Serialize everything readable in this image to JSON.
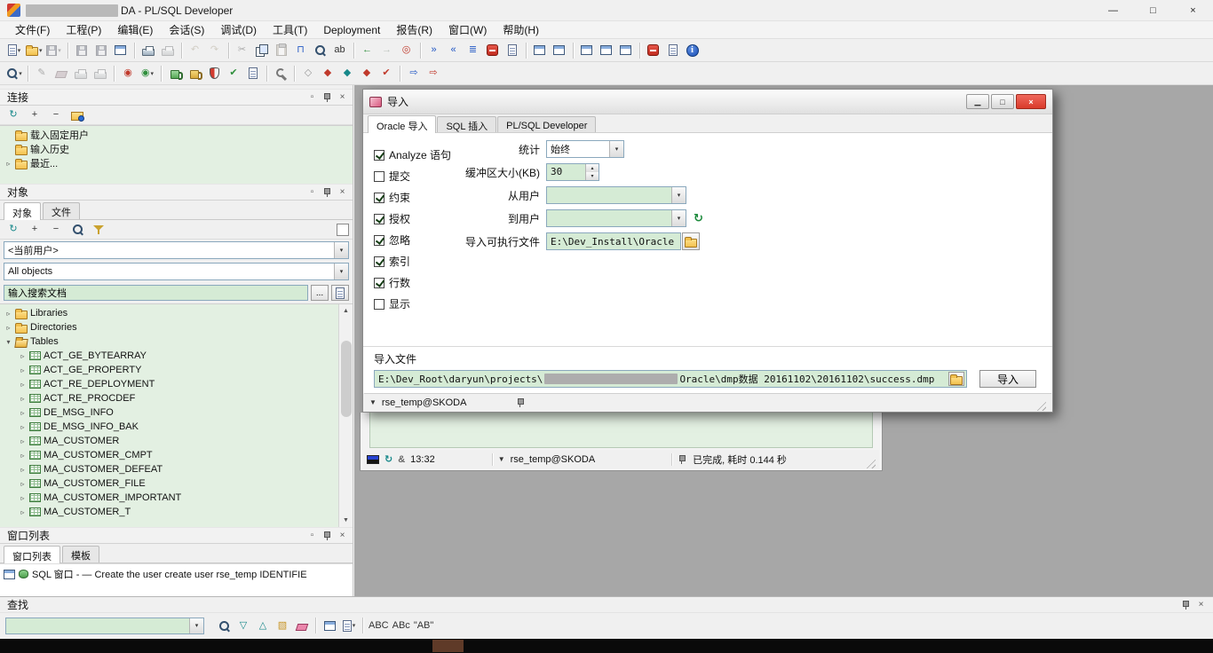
{
  "window": {
    "title_visible": "DA - PL/SQL Developer",
    "controls": {
      "minimize": "—",
      "maximize": "□",
      "close": "×"
    }
  },
  "menu": {
    "items": [
      {
        "label": "文件(F)",
        "name": "menu-file"
      },
      {
        "label": "工程(P)",
        "name": "menu-project"
      },
      {
        "label": "编辑(E)",
        "name": "menu-edit"
      },
      {
        "label": "会话(S)",
        "name": "menu-session"
      },
      {
        "label": "调试(D)",
        "name": "menu-debug"
      },
      {
        "label": "工具(T)",
        "name": "menu-tools"
      },
      {
        "label": "Deployment",
        "name": "menu-deployment"
      },
      {
        "label": "报告(R)",
        "name": "menu-reports"
      },
      {
        "label": "窗口(W)",
        "name": "menu-window"
      },
      {
        "label": "帮助(H)",
        "name": "menu-help"
      }
    ]
  },
  "toolbar1": {
    "items": [
      {
        "name": "new-icon",
        "icon": "doc",
        "dd": "▾"
      },
      {
        "name": "open-icon",
        "icon": "folder",
        "dd": "▾"
      },
      {
        "name": "save-as-icon",
        "icon": "floppy",
        "grayed": true,
        "dd": "▾"
      },
      {
        "name": "separator",
        "type": "sep",
        "ia": "false"
      },
      {
        "name": "save-icon",
        "icon": "floppy",
        "grayed": true
      },
      {
        "name": "save-all-icon",
        "icon": "floppy",
        "grayed": true
      },
      {
        "name": "close-window-icon",
        "icon": "win"
      },
      {
        "name": "separator",
        "type": "sep",
        "ia": "false"
      },
      {
        "name": "print-icon",
        "icon": "printer"
      },
      {
        "name": "print-preview-icon",
        "icon": "printer",
        "grayed": true
      },
      {
        "name": "separator",
        "type": "sep",
        "ia": "false"
      },
      {
        "name": "undo-icon",
        "g": "↶",
        "tone": "gold",
        "grayed": true
      },
      {
        "name": "redo-icon",
        "g": "↷",
        "tone": "gold",
        "grayed": true
      },
      {
        "name": "separator",
        "type": "sep",
        "ia": "false"
      },
      {
        "name": "cut-icon",
        "g": "✂",
        "tone": "dark",
        "grayed": true
      },
      {
        "name": "copy-icon",
        "icon": "copy"
      },
      {
        "name": "paste-icon",
        "icon": "paste",
        "grayed": true
      },
      {
        "name": "clamp-icon",
        "g": "⊓",
        "tone": "blue"
      },
      {
        "name": "find-icon",
        "icon": "magnifier"
      },
      {
        "name": "replace-icon",
        "g": "ab",
        "tone": "dark"
      },
      {
        "name": "separator",
        "type": "sep",
        "ia": "false"
      },
      {
        "name": "back-icon",
        "g": "←",
        "tone": "green"
      },
      {
        "name": "forward-icon",
        "g": "→",
        "tone": "green",
        "grayed": true
      },
      {
        "name": "navigator-icon",
        "g": "◎",
        "tone": "red"
      },
      {
        "name": "separator",
        "type": "sep",
        "ia": "false"
      },
      {
        "name": "indent-icon",
        "g": "»",
        "tone": "blue"
      },
      {
        "name": "outdent-icon",
        "g": "«",
        "tone": "blue"
      },
      {
        "name": "sort-icon",
        "g": "≣",
        "tone": "blue"
      },
      {
        "name": "stop-icon",
        "icon": "stop"
      },
      {
        "name": "log-icon",
        "icon": "doc"
      },
      {
        "name": "separator",
        "type": "sep",
        "ia": "false"
      },
      {
        "name": "next-window-icon",
        "icon": "win"
      },
      {
        "name": "window-list-icon",
        "icon": "win"
      },
      {
        "name": "separator",
        "type": "sep",
        "ia": "false"
      },
      {
        "name": "tile-windows-icon",
        "icon": "win"
      },
      {
        "name": "cascade-windows-icon",
        "icon": "win"
      },
      {
        "name": "layout-windows-icon",
        "icon": "win"
      },
      {
        "name": "separator",
        "type": "sep",
        "ia": "false"
      },
      {
        "name": "record-stop-icon",
        "icon": "stop"
      },
      {
        "name": "report-icon",
        "icon": "doc"
      },
      {
        "name": "about-icon",
        "icon": "info"
      }
    ]
  },
  "toolbar2": {
    "items": [
      {
        "name": "zoom-icon",
        "icon": "magnifier",
        "dd": "▾"
      },
      {
        "name": "separator",
        "type": "sep",
        "ia": "false"
      },
      {
        "name": "edit-data-icon",
        "g": "✎",
        "tone": "dark",
        "grayed": true
      },
      {
        "name": "eraser-icon",
        "icon": "eraser",
        "grayed": true
      },
      {
        "name": "print-result-icon",
        "icon": "printer",
        "grayed": true
      },
      {
        "name": "export-icon",
        "icon": "printer",
        "grayed": true
      },
      {
        "name": "separator",
        "type": "sep",
        "ia": "false"
      },
      {
        "name": "stamp-icon",
        "g": "◉",
        "tone": "red"
      },
      {
        "name": "stamp-options-icon",
        "g": "◉",
        "tone": "green",
        "dd": "▾"
      },
      {
        "name": "separator",
        "type": "sep",
        "ia": "false"
      },
      {
        "name": "commit-icon",
        "icon": "mug",
        "tone": "green"
      },
      {
        "name": "rollback-icon",
        "icon": "mug",
        "tone": "gold"
      },
      {
        "name": "compile-icon",
        "icon": "shield"
      },
      {
        "name": "syntax-check-icon",
        "g": "✔",
        "tone": "green"
      },
      {
        "name": "describe-icon",
        "icon": "doc"
      },
      {
        "name": "separator",
        "type": "sep",
        "ia": "false"
      },
      {
        "name": "preferences-icon",
        "icon": "wrench"
      },
      {
        "name": "separator",
        "type": "sep",
        "ia": "false"
      },
      {
        "name": "breakpoint-off-icon",
        "g": "◇",
        "tone": "gray"
      },
      {
        "name": "breakpoint-icon",
        "g": "◆",
        "tone": "red"
      },
      {
        "name": "watch-icon",
        "g": "◆",
        "tone": "teal"
      },
      {
        "name": "breakpoint-2-icon",
        "g": "◆",
        "tone": "red"
      },
      {
        "name": "test-icon",
        "g": "✔",
        "tone": "red"
      },
      {
        "name": "separator",
        "type": "sep",
        "ia": "false"
      },
      {
        "name": "step-into-icon",
        "g": "⇨",
        "tone": "blue"
      },
      {
        "name": "run-icon",
        "g": "⇨",
        "tone": "red"
      }
    ]
  },
  "connections": {
    "title": "连接",
    "toolbar": [
      {
        "name": "refresh-connections-icon",
        "g": "↻",
        "tone": "teal"
      },
      {
        "name": "add-connection-icon",
        "g": "+",
        "tone": "dark"
      },
      {
        "name": "remove-connection-icon",
        "g": "−",
        "tone": "dark"
      },
      {
        "name": "connection-users-icon",
        "icon": "userfolder"
      }
    ],
    "tree": [
      {
        "arrow": "",
        "icon": "folder",
        "label": "载入固定用户",
        "indent": 0
      },
      {
        "arrow": "",
        "icon": "folder",
        "label": "输入历史",
        "indent": 0
      },
      {
        "arrow": "▹",
        "icon": "folder",
        "label": "最近...",
        "indent": 0
      }
    ]
  },
  "objects": {
    "title": "对象",
    "tabs": [
      {
        "label": "对象",
        "active": true,
        "name": "tab-objects"
      },
      {
        "label": "文件",
        "name": "tab-files"
      }
    ],
    "toolbar": [
      {
        "name": "refresh-objects-icon",
        "g": "↻",
        "tone": "teal"
      },
      {
        "name": "expand-icon",
        "g": "+",
        "tone": "dark"
      },
      {
        "name": "collapse-icon",
        "g": "−",
        "tone": "dark"
      },
      {
        "name": "find-object-icon",
        "icon": "magnifier"
      },
      {
        "name": "filter-icon",
        "icon": "funnel"
      }
    ],
    "filter_user": "<当前用户>",
    "filter_type": "All objects",
    "search_value": "输入搜索文档",
    "more_button": "...",
    "tree": [
      {
        "arrow": "▹",
        "icon": "folder",
        "label": "Libraries",
        "indent": 0
      },
      {
        "arrow": "▹",
        "icon": "folder",
        "label": "Directories",
        "indent": 0
      },
      {
        "arrow": "▾",
        "icon": "folder-open",
        "label": "Tables",
        "indent": 0
      },
      {
        "arrow": "▹",
        "icon": "table",
        "label": "ACT_GE_BYTEARRAY",
        "indent": 1
      },
      {
        "arrow": "▹",
        "icon": "table",
        "label": "ACT_GE_PROPERTY",
        "indent": 1
      },
      {
        "arrow": "▹",
        "icon": "table",
        "label": "ACT_RE_DEPLOYMENT",
        "indent": 1
      },
      {
        "arrow": "▹",
        "icon": "table",
        "label": "ACT_RE_PROCDEF",
        "indent": 1
      },
      {
        "arrow": "▹",
        "icon": "table",
        "label": "DE_MSG_INFO",
        "indent": 1
      },
      {
        "arrow": "▹",
        "icon": "table",
        "label": "DE_MSG_INFO_BAK",
        "indent": 1
      },
      {
        "arrow": "▹",
        "icon": "table",
        "label": "MA_CUSTOMER",
        "indent": 1
      },
      {
        "arrow": "▹",
        "icon": "table",
        "label": "MA_CUSTOMER_CMPT",
        "indent": 1
      },
      {
        "arrow": "▹",
        "icon": "table",
        "label": "MA_CUSTOMER_DEFEAT",
        "indent": 1
      },
      {
        "arrow": "▹",
        "icon": "table",
        "label": "MA_CUSTOMER_FILE",
        "indent": 1
      },
      {
        "arrow": "▹",
        "icon": "table",
        "label": "MA_CUSTOMER_IMPORTANT",
        "indent": 1
      },
      {
        "arrow": "▹",
        "icon": "table",
        "label": "MA_CUSTOMER_T",
        "indent": 1
      }
    ]
  },
  "window_list": {
    "title": "窗口列表",
    "tabs": [
      {
        "label": "窗口列表",
        "active": true,
        "name": "tab-window-list"
      },
      {
        "label": "模板",
        "name": "tab-templates"
      }
    ],
    "item": "SQL 窗口 - — Create the user create user rse_temp IDENTIFIE"
  },
  "dialog": {
    "title": "导入",
    "buttons": [
      {
        "name": "dialog-minimize-button",
        "glyph": "▁"
      },
      {
        "name": "dialog-maximize-button",
        "glyph": "□"
      },
      {
        "name": "dialog-close-button",
        "glyph": "×",
        "close": true
      }
    ],
    "tabs": [
      {
        "label": "Oracle 导入",
        "active": true,
        "name": "tab-oracle-import"
      },
      {
        "label": "SQL 插入",
        "name": "tab-sql-insert"
      },
      {
        "label": "PL/SQL Developer",
        "name": "tab-plsql-developer"
      }
    ],
    "options": [
      {
        "name": "analyze-checkbox",
        "label": "Analyze 语句",
        "checked": true
      },
      {
        "name": "commit-checkbox",
        "label": "提交",
        "checked": false
      },
      {
        "name": "constraints-checkbox",
        "label": "约束",
        "checked": true
      },
      {
        "name": "grants-checkbox",
        "label": "授权",
        "checked": true
      },
      {
        "name": "ignore-checkbox",
        "label": "忽略",
        "checked": true
      },
      {
        "name": "indexes-checkbox",
        "label": "索引",
        "checked": true
      },
      {
        "name": "rows-checkbox",
        "label": "行数",
        "checked": true
      },
      {
        "name": "show-checkbox",
        "label": "显示",
        "checked": false
      }
    ],
    "fields": {
      "statistics_label": "统计",
      "statistics_value": "始终",
      "buffer_label": "缓冲区大小(KB)",
      "buffer_value": "30",
      "from_user_label": "从用户",
      "to_user_label": "到用户",
      "executable_label": "导入可执行文件",
      "executable_value": "E:\\Dev_Install\\Oracle"
    },
    "import_file": {
      "section_label": "导入文件",
      "path_prefix": "E:\\Dev_Root\\daryun\\projects\\",
      "path_suffix": "Oracle\\dmp数据 20161102\\20161102\\success.dmp",
      "import_button": "导入"
    },
    "statusbar": {
      "connection": "rse_temp@SKODA"
    }
  },
  "editor_window": {
    "time": "13:32",
    "amp": "&",
    "connection": "rse_temp@SKODA",
    "status": "已完成, 耗时 0.144 秒"
  },
  "find_panel": {
    "title": "查找",
    "input_value": "",
    "buttons": [
      {
        "name": "pin-button",
        "icon": "pin"
      },
      {
        "name": "close-panel-button",
        "glyph": "×"
      }
    ],
    "toolbar": [
      {
        "name": "find-next-icon",
        "icon": "magnifier"
      },
      {
        "name": "direction-down-icon",
        "g": "▽",
        "tone": "teal"
      },
      {
        "name": "direction-up-icon",
        "g": "△",
        "tone": "teal"
      },
      {
        "name": "highlight-icon",
        "g": "▧",
        "tone": "gold"
      },
      {
        "name": "clear-highlight-icon",
        "icon": "eraser"
      },
      {
        "name": "separator",
        "type": "sep",
        "ia": "false"
      },
      {
        "name": "results-window-icon",
        "icon": "win"
      },
      {
        "name": "search-files-icon",
        "icon": "doc",
        "dd": "▾"
      },
      {
        "name": "separator",
        "type": "sep",
        "ia": "false"
      },
      {
        "name": "whole-word-icon",
        "g": "ABC",
        "tone": "dark"
      },
      {
        "name": "match-case-icon",
        "g": "ABc",
        "tone": "dark"
      },
      {
        "name": "quoted-search-icon",
        "g": "\"AB\"",
        "tone": "dark"
      }
    ]
  },
  "ui": {
    "chevron": "▾",
    "spin_up": "▴",
    "spin_down": "▾",
    "refresh": "↻",
    "tri_down": "▼",
    "arrow_up": "▲",
    "arrow_down": "▼",
    "panel_buttons": [
      {
        "name": "float-button",
        "glyph": "▫"
      },
      {
        "name": "pin-button",
        "icon": "pin"
      },
      {
        "name": "close-panel-button",
        "glyph": "×"
      }
    ]
  }
}
